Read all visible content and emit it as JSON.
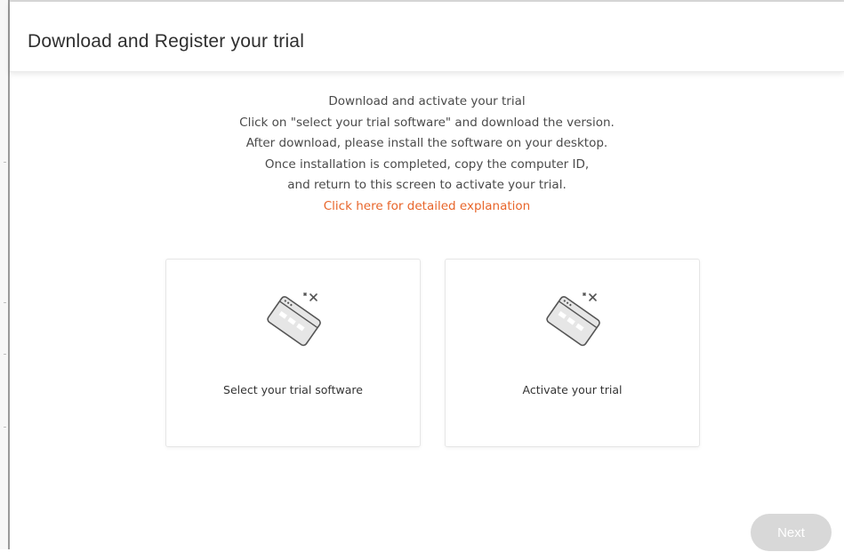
{
  "dialog": {
    "title": "Download and Register your trial"
  },
  "intro": {
    "lines": [
      "Download and activate your trial",
      "Click on \"select your trial software\" and download the version.",
      "After download, please install the software on your desktop.",
      "Once installation is completed, copy the computer ID,",
      "and return to this screen to activate your trial."
    ],
    "link_text": "Click here for detailed explanation"
  },
  "cards": [
    {
      "label": "Select your trial software",
      "icon": "software-window-icon"
    },
    {
      "label": "Activate your trial",
      "icon": "software-window-icon"
    }
  ],
  "footer": {
    "next_label": "Next"
  },
  "colors": {
    "link": "#e8652a",
    "next_button_disabled": "#d8d8d8",
    "text": "#4a4a4a",
    "icon_stroke": "#555555",
    "icon_fill": "#e6e6e6"
  }
}
